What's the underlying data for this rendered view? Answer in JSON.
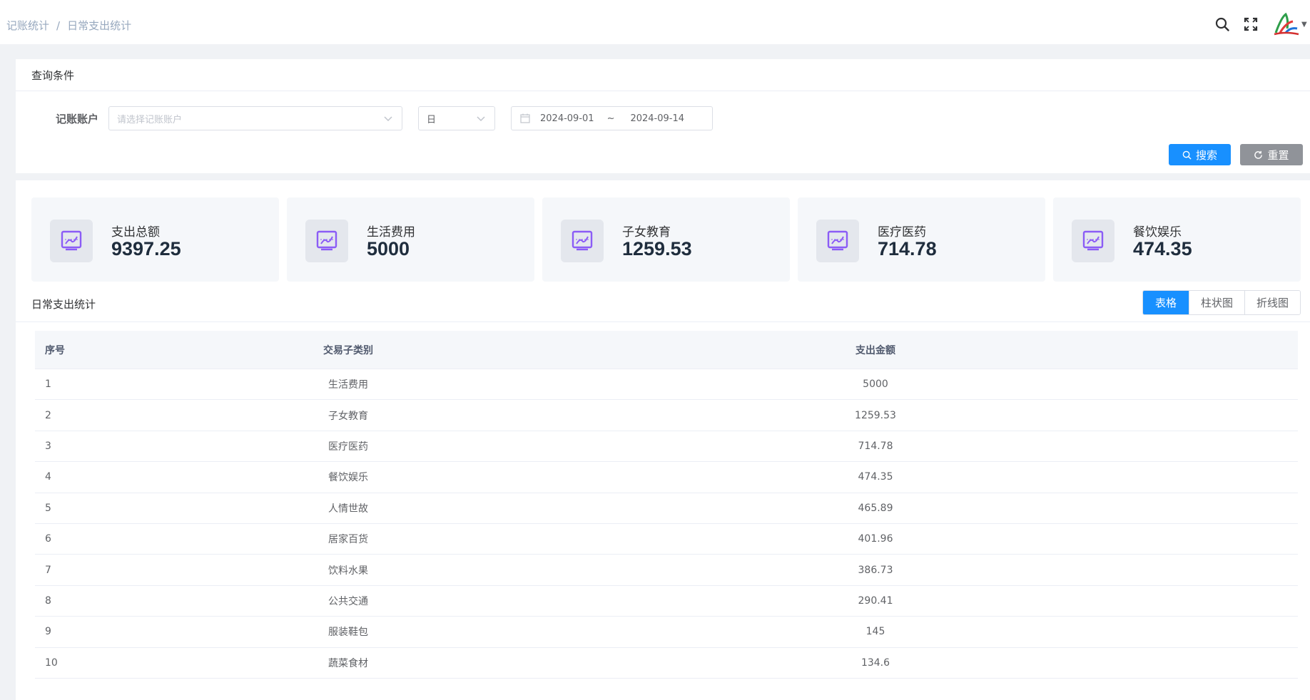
{
  "breadcrumb": {
    "items": [
      "记账统计",
      "日常支出统计"
    ],
    "separator": "/"
  },
  "topbar": {
    "icons": [
      "search-icon",
      "fullscreen-icon",
      "avatar-logo",
      "caret-down-icon"
    ]
  },
  "query": {
    "title": "查询条件",
    "account_label": "记账账户",
    "account_placeholder": "请选择记账账户",
    "unit_value": "日",
    "date_start": "2024-09-01",
    "date_separator": "~",
    "date_end": "2024-09-14",
    "search_label": "搜索",
    "reset_label": "重置"
  },
  "cards": [
    {
      "label": "支出总额",
      "value": "9397.25"
    },
    {
      "label": "生活费用",
      "value": "5000"
    },
    {
      "label": "子女教育",
      "value": "1259.53"
    },
    {
      "label": "医疗医药",
      "value": "714.78"
    },
    {
      "label": "餐饮娱乐",
      "value": "474.35"
    }
  ],
  "section": {
    "title": "日常支出统计",
    "views": [
      "表格",
      "柱状图",
      "折线图"
    ],
    "active_view": "表格"
  },
  "table": {
    "headers": [
      "序号",
      "交易子类别",
      "支出金额"
    ],
    "rows": [
      [
        "1",
        "生活费用",
        "5000"
      ],
      [
        "2",
        "子女教育",
        "1259.53"
      ],
      [
        "3",
        "医疗医药",
        "714.78"
      ],
      [
        "4",
        "餐饮娱乐",
        "474.35"
      ],
      [
        "5",
        "人情世故",
        "465.89"
      ],
      [
        "6",
        "居家百货",
        "401.96"
      ],
      [
        "7",
        "饮料水果",
        "386.73"
      ],
      [
        "8",
        "公共交通",
        "290.41"
      ],
      [
        "9",
        "服装鞋包",
        "145"
      ],
      [
        "10",
        "蔬菜食材",
        "134.6"
      ]
    ]
  },
  "colors": {
    "primary": "#1890ff",
    "reset": "#909399",
    "card_icon": "#8b5cf6"
  }
}
